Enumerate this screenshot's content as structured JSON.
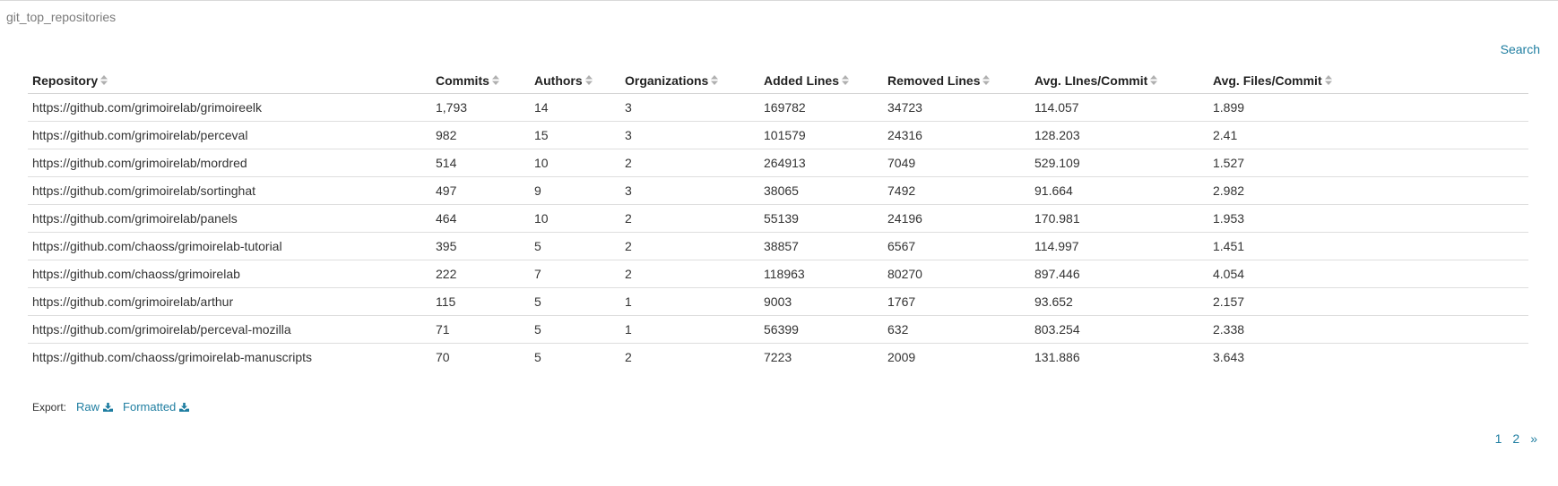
{
  "panel": {
    "title": "git_top_repositories",
    "search_label": "Search"
  },
  "table": {
    "columns": [
      "Repository",
      "Commits",
      "Authors",
      "Organizations",
      "Added Lines",
      "Removed Lines",
      "Avg. LInes/Commit",
      "Avg. Files/Commit"
    ],
    "rows": [
      [
        "https://github.com/grimoirelab/grimoireelk",
        "1,793",
        "14",
        "3",
        "169782",
        "34723",
        "114.057",
        "1.899"
      ],
      [
        "https://github.com/grimoirelab/perceval",
        "982",
        "15",
        "3",
        "101579",
        "24316",
        "128.203",
        "2.41"
      ],
      [
        "https://github.com/grimoirelab/mordred",
        "514",
        "10",
        "2",
        "264913",
        "7049",
        "529.109",
        "1.527"
      ],
      [
        "https://github.com/grimoirelab/sortinghat",
        "497",
        "9",
        "3",
        "38065",
        "7492",
        "91.664",
        "2.982"
      ],
      [
        "https://github.com/grimoirelab/panels",
        "464",
        "10",
        "2",
        "55139",
        "24196",
        "170.981",
        "1.953"
      ],
      [
        "https://github.com/chaoss/grimoirelab-tutorial",
        "395",
        "5",
        "2",
        "38857",
        "6567",
        "114.997",
        "1.451"
      ],
      [
        "https://github.com/chaoss/grimoirelab",
        "222",
        "7",
        "2",
        "118963",
        "80270",
        "897.446",
        "4.054"
      ],
      [
        "https://github.com/grimoirelab/arthur",
        "115",
        "5",
        "1",
        "9003",
        "1767",
        "93.652",
        "2.157"
      ],
      [
        "https://github.com/grimoirelab/perceval-mozilla",
        "71",
        "5",
        "1",
        "56399",
        "632",
        "803.254",
        "2.338"
      ],
      [
        "https://github.com/chaoss/grimoirelab-manuscripts",
        "70",
        "5",
        "2",
        "7223",
        "2009",
        "131.886",
        "3.643"
      ]
    ]
  },
  "export": {
    "label": "Export:",
    "raw_label": "Raw",
    "formatted_label": "Formatted",
    "icon": "download-icon"
  },
  "pagination": {
    "pages": [
      "1",
      "2"
    ],
    "next": "»"
  },
  "colors": {
    "link": "#1f7ea1",
    "title": "#7b7b7b",
    "text": "#333333"
  }
}
